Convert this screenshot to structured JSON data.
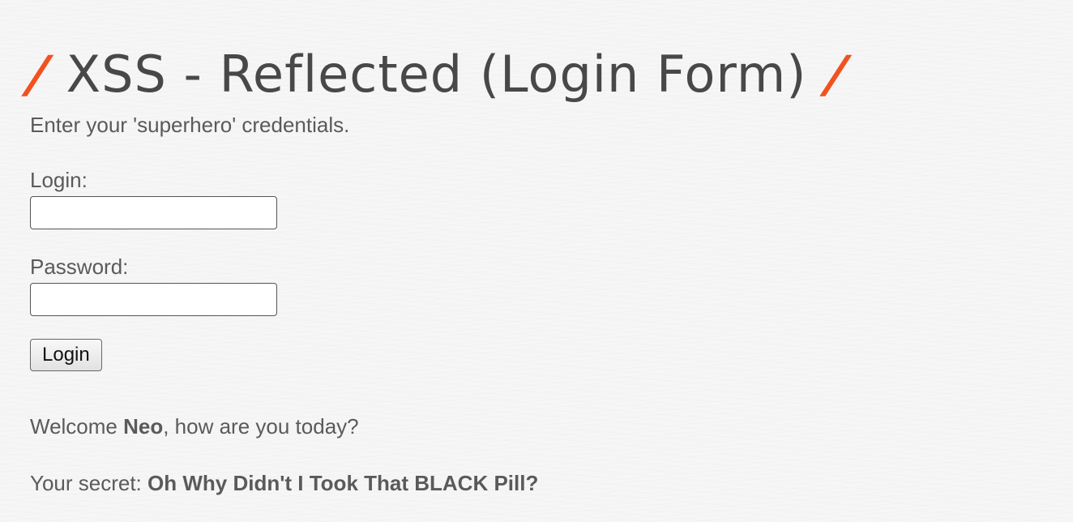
{
  "header": {
    "slash_left": "/",
    "title": "XSS - Reflected (Login Form)",
    "slash_right": "/",
    "accent_color": "#f1521f"
  },
  "form": {
    "intro": "Enter your 'superhero' credentials.",
    "login_label": "Login:",
    "login_value": "",
    "password_label": "Password:",
    "password_value": "",
    "submit_label": "Login"
  },
  "result": {
    "welcome_prefix": "Welcome ",
    "user_name": "Neo",
    "welcome_suffix": ", how are you today?",
    "secret_label": "Your secret: ",
    "secret_value": "Oh Why Didn't I Took That BLACK Pill?"
  }
}
